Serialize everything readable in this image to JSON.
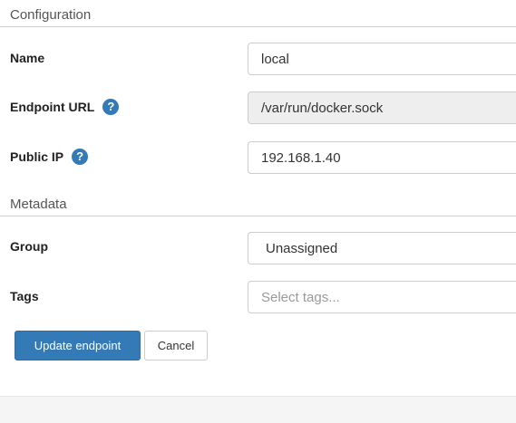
{
  "configuration": {
    "title": "Configuration",
    "name_label": "Name",
    "name_value": "local",
    "endpoint_url_label": "Endpoint URL",
    "endpoint_url_value": "/var/run/docker.sock",
    "public_ip_label": "Public IP",
    "public_ip_value": "192.168.1.40"
  },
  "metadata": {
    "title": "Metadata",
    "group_label": "Group",
    "group_value": "Unassigned",
    "tags_label": "Tags",
    "tags_placeholder": "Select tags..."
  },
  "actions": {
    "update_label": "Update endpoint",
    "cancel_label": "Cancel"
  },
  "icons": {
    "help_glyph": "?"
  },
  "colors": {
    "primary": "#337ab7",
    "help_icon": "#337ab7",
    "disabled_input_bg": "#eeeeee"
  }
}
